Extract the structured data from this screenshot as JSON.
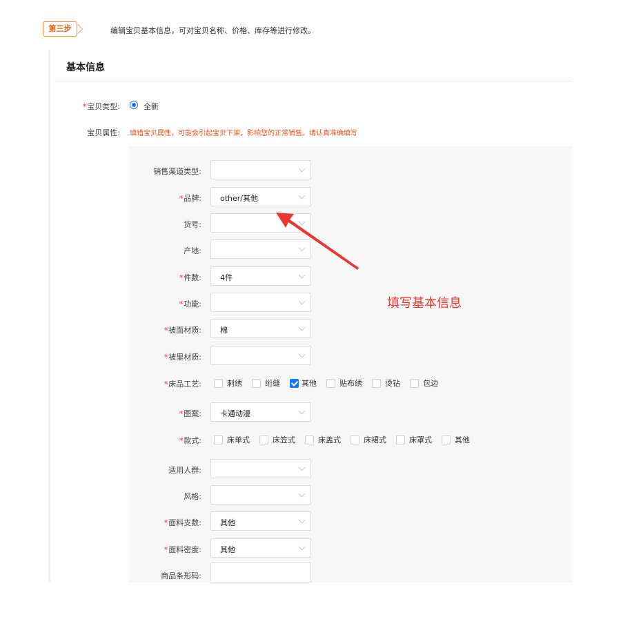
{
  "step": {
    "badge": "第三步",
    "description": "编辑宝贝基本信息，可对宝贝名称、价格、库存等进行修改。"
  },
  "section": {
    "title": "基本信息"
  },
  "item_type": {
    "label": "宝贝类型:",
    "required": true,
    "option": "全新"
  },
  "item_attr": {
    "label": "宝贝属性:",
    "warning": "填错宝贝属性，可能会引起宝贝下架，影响您的正常销售。请认真准确填写"
  },
  "fields": [
    {
      "label": "销售渠道类型:",
      "required": false,
      "value": ""
    },
    {
      "label": "品牌:",
      "required": true,
      "value": "other/其他"
    },
    {
      "label": "货号:",
      "required": false,
      "value": ""
    },
    {
      "label": "产地:",
      "required": false,
      "value": ""
    },
    {
      "label": "件数:",
      "required": true,
      "value": "4件"
    },
    {
      "label": "功能:",
      "required": true,
      "value": ""
    },
    {
      "label": "被面材质:",
      "required": true,
      "value": "棉"
    },
    {
      "label": "被里材质:",
      "required": true,
      "value": ""
    }
  ],
  "craft": {
    "label": "床品工艺:",
    "required": true,
    "options": [
      {
        "label": "刺绣",
        "checked": false
      },
      {
        "label": "绗缝",
        "checked": false
      },
      {
        "label": "其他",
        "checked": true
      },
      {
        "label": "贴布绣",
        "checked": false
      },
      {
        "label": "烫钻",
        "checked": false
      },
      {
        "label": "包边",
        "checked": false
      }
    ]
  },
  "pattern": {
    "label": "图案:",
    "required": true,
    "value": "卡通动漫"
  },
  "style": {
    "label": "款式:",
    "required": true,
    "options": [
      {
        "label": "床单式",
        "checked": false
      },
      {
        "label": "床笠式",
        "checked": false
      },
      {
        "label": "床盖式",
        "checked": false
      },
      {
        "label": "床裙式",
        "checked": false
      },
      {
        "label": "床罩式",
        "checked": false
      },
      {
        "label": "其他",
        "checked": false
      }
    ]
  },
  "fields2": [
    {
      "label": "适用人群:",
      "required": false,
      "value": ""
    },
    {
      "label": "风格:",
      "required": false,
      "value": ""
    },
    {
      "label": "面料支数:",
      "required": true,
      "value": "其他"
    },
    {
      "label": "面料密度:",
      "required": true,
      "value": "其他"
    }
  ],
  "barcode": {
    "label": "商品条形码:",
    "value": ""
  },
  "annotation": {
    "text": "填写基本信息",
    "color": "#e8382f"
  },
  "colors": {
    "accent": "#1677ff",
    "required": "#f5222d",
    "warning": "#e8531f",
    "step": "#f08a3c"
  }
}
